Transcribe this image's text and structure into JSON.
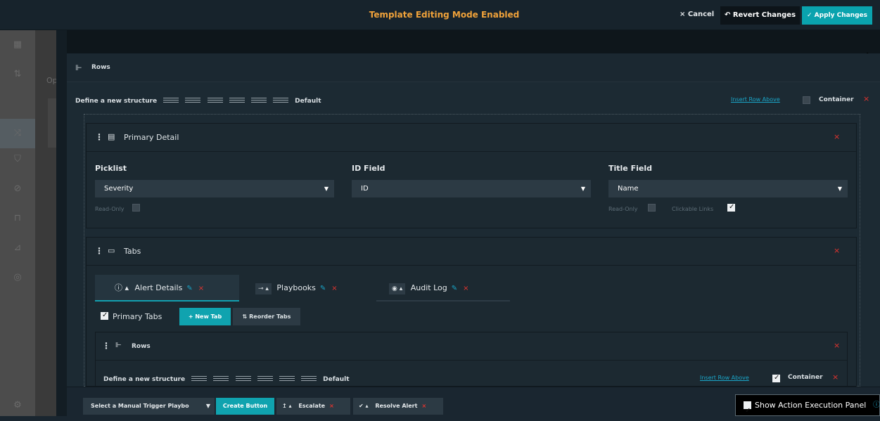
{
  "topbar": {
    "title": "Template Editing Mode Enabled",
    "cancel": "× Cancel",
    "revert": "↶ Revert Changes",
    "apply": "✓ Apply Changes"
  },
  "sidebar": {
    "overlay_text": "Op",
    "icons": [
      "grid-icon",
      "sort-icon",
      "shuffle-icon",
      "shield-icon",
      "compass-icon",
      "briefcase-icon",
      "chart-icon",
      "globe-icon",
      "settings-icon"
    ]
  },
  "rows": {
    "icon": "rows-icon",
    "label": "Rows",
    "define": "Define a new structure",
    "default": "Default",
    "insert": "Insert Row Above",
    "container": "Container"
  },
  "primary": {
    "title": "Primary Detail",
    "fields": [
      {
        "label": "Picklist",
        "value": "Severity",
        "read_only": "Read-Only"
      },
      {
        "label": "ID Field",
        "value": "ID"
      },
      {
        "label": "Title Field",
        "value": "Name",
        "read_only": "Read-Only",
        "clickable": "Clickable Links"
      }
    ]
  },
  "tabs": {
    "title": "Tabs",
    "items": [
      {
        "label": "Alert Details",
        "icon": "ⓘ ▴"
      },
      {
        "label": "Playbooks",
        "icon": "⊸ ▴"
      },
      {
        "label": "Audit Log",
        "icon": "◉ ▴"
      }
    ],
    "primary_tabs": "Primary Tabs",
    "new_tab": "+ New Tab",
    "reorder": "⇅ Reorder Tabs"
  },
  "inner_rows": {
    "label": "Rows",
    "define": "Define a new structure",
    "default": "Default",
    "insert": "Insert Row Above",
    "container": "Container"
  },
  "bottombar": {
    "select": "Select a Manual Trigger Playbo",
    "create": "Create Button",
    "escalate": "Escalate",
    "resolve": "Resolve Alert",
    "show_panel": "Show Action Execution Panel"
  }
}
